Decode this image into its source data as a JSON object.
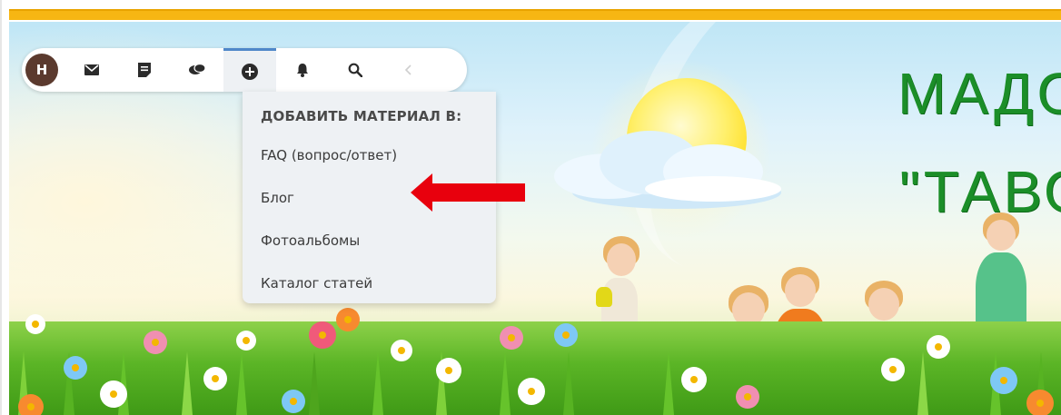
{
  "toolbar": {
    "avatar_letter": "Н",
    "icons": [
      "mail-icon",
      "note-icon",
      "chat-icon",
      "add-circle-icon",
      "bell-icon",
      "search-icon",
      "chevron-left-icon"
    ]
  },
  "dropdown": {
    "header": "ДОБАВИТЬ МАТЕРИАЛ В:",
    "items": [
      "FAQ (вопрос/ответ)",
      "Блог",
      "Фотоальбомы",
      "Каталог статей"
    ]
  },
  "banner": {
    "title_line1": "МАДО",
    "title_line2": "\"ТАВО"
  },
  "colors": {
    "top_bar": "#f7b613",
    "avatar_bg": "#5b3a2e",
    "active_tab_border": "#4f87c9",
    "dropdown_bg": "#eef1f4",
    "arrow": "#e8000d",
    "title_green": "#1b8e28"
  }
}
